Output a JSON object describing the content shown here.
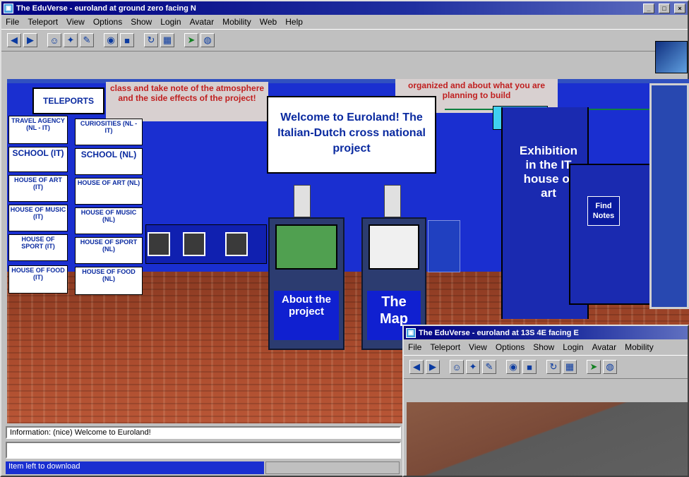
{
  "main_window": {
    "title": "The EduVerse - euroland at ground zero facing N",
    "menu": [
      "File",
      "Teleport",
      "View",
      "Options",
      "Show",
      "Login",
      "Avatar",
      "Mobility",
      "Web",
      "Help"
    ],
    "controls": {
      "minimize": "_",
      "maximize": "□",
      "close": "×"
    }
  },
  "toolbar_icons": [
    "back-arrow-icon",
    "forward-arrow-icon",
    "avatar-icon",
    "world-icon",
    "tools-icon",
    "camera-icon",
    "film-icon",
    "rotate-icon",
    "map-icon",
    "teleport-icon",
    "globe-icon"
  ],
  "scene": {
    "banner_left": "class and take note of the atmosphere and the side effects of the project!",
    "banner_right": "organized and about what you are planning to build",
    "teleports_label": "TELEPORTS",
    "welcome_sign": "Welcome to Euroland! The Italian-Dutch cross national project",
    "exhibition_sign": "Exhibition in the IT house of art",
    "rules_sign": "Find Notes",
    "kiosk_about": "About the project",
    "kiosk_map": "The Map",
    "teleport_buttons": [
      "TRAVEL AGENCY (NL - IT)",
      "CURIOSITIES (NL - IT)",
      "SCHOOL (IT)",
      "SCHOOL (NL)",
      "HOUSE OF ART (IT)",
      "HOUSE OF ART (NL)",
      "HOUSE OF MUSIC (IT)",
      "HOUSE OF MUSIC (NL)",
      "HOUSE OF SPORT (IT)",
      "HOUSE OF SPORT (NL)",
      "HOUSE OF FOOD (IT)",
      "HOUSE OF FOOD (NL)"
    ]
  },
  "chat_line": "Information: (nice)       Welcome to Euroland!",
  "chat_input": "",
  "status_text": "Item left to download",
  "second_window": {
    "title": "The EduVerse - euroland at 13S 4E facing E",
    "menu": [
      "File",
      "Teleport",
      "View",
      "Options",
      "Show",
      "Login",
      "Avatar",
      "Mobility"
    ]
  }
}
